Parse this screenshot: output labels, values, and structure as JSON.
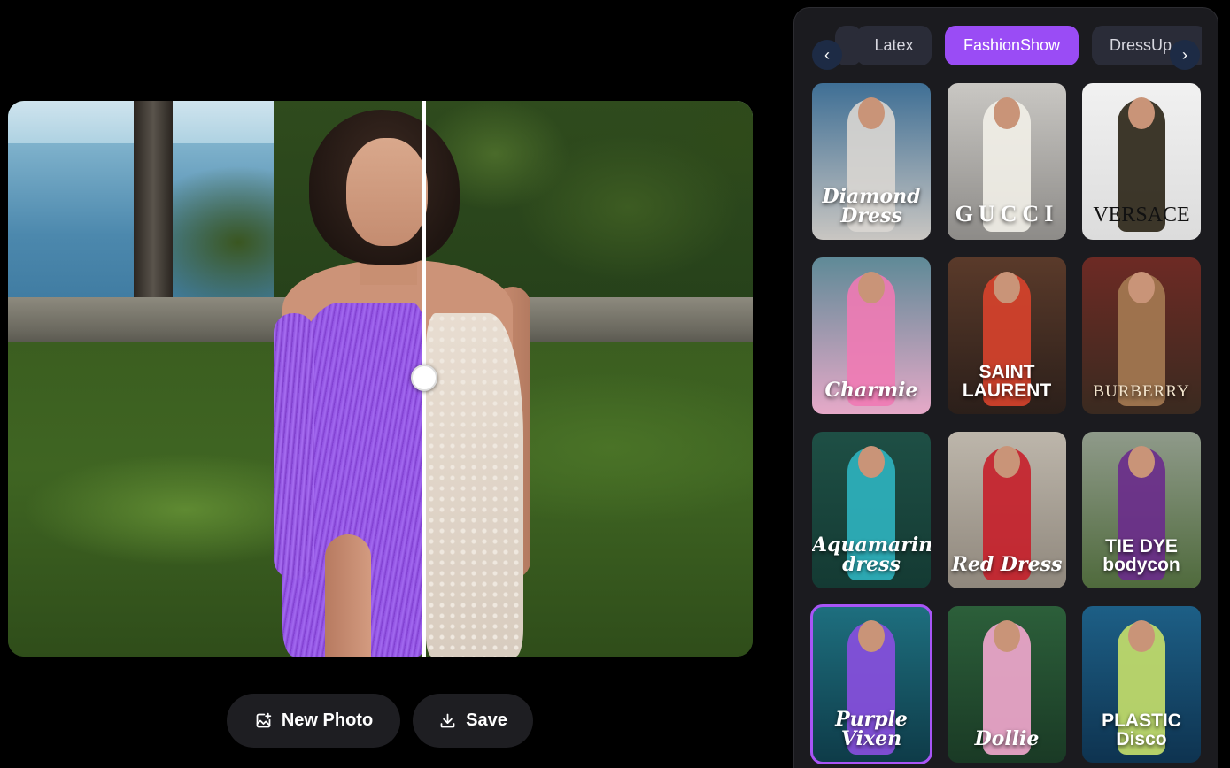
{
  "viewer": {
    "handle_icon": "drag-handle-icon"
  },
  "actions": {
    "new_photo_label": "New Photo",
    "new_photo_icon": "add-image-icon",
    "save_label": "Save",
    "save_icon": "download-icon"
  },
  "tabs": {
    "prev_symbol": "‹",
    "next_symbol": "›",
    "items": [
      {
        "label": ""
      },
      {
        "label": "Latex"
      },
      {
        "label": "FashionShow",
        "active": true
      },
      {
        "label": "DressUp"
      }
    ]
  },
  "styles": [
    {
      "label": "Diamond Dress",
      "line1": "Diamond",
      "line2": "Dress",
      "bg": [
        "#3f6f95",
        "#c9c6c2"
      ],
      "outfit": "#d9d6d2"
    },
    {
      "label": "GUCCI",
      "bg": [
        "#c9c7c3",
        "#8d8b88"
      ],
      "outfit": "#f2efe8"
    },
    {
      "label": "VERSACE",
      "bg": [
        "#f1f1f1",
        "#dcdcdc"
      ],
      "outfit": "#2a2315"
    },
    {
      "label": "Charmie",
      "bg": [
        "#5f8a97",
        "#e6a9c8"
      ],
      "outfit": "#f07ab4"
    },
    {
      "label": "SAINT LAURENT",
      "line1": "SAINT",
      "line2": "LAURENT",
      "bg": [
        "#5a3a2a",
        "#2b1f1a"
      ],
      "outfit": "#d8432c"
    },
    {
      "label": "BURBERRY",
      "bg": [
        "#6d2a24",
        "#3a2a20"
      ],
      "outfit": "#a57a52"
    },
    {
      "label": "Aquamarine dress",
      "line1": "Aquamarine",
      "line2": "dress",
      "bg": [
        "#1e4f45",
        "#143a33"
      ],
      "outfit": "#2fb4c0"
    },
    {
      "label": "Red Dress",
      "bg": [
        "#bdb6ab",
        "#8f877c"
      ],
      "outfit": "#c71f2a"
    },
    {
      "label": "TIE DYE bodycon",
      "line1": "TIE DYE",
      "line2": "bodycon",
      "bg": [
        "#8f9a8a",
        "#4f6a3c"
      ],
      "outfit": "#6a2b8c"
    },
    {
      "label": "Purple Vixen",
      "bg": [
        "#1e6f7f",
        "#0e3b48"
      ],
      "outfit": "#8a4fe0",
      "selected": true
    },
    {
      "label": "Dollie",
      "bg": [
        "#2c5f3a",
        "#1a3a25"
      ],
      "outfit": "#f3a9cf"
    },
    {
      "label": "PLASTIC Disco",
      "line1": "PLASTIC",
      "line2": "Disco",
      "bg": [
        "#1d5f86",
        "#0e3350"
      ],
      "outfit": "#c7e06a"
    }
  ],
  "colors": {
    "accent": "#9a4cf5",
    "panel_bg": "#1b1b1f",
    "tab_bg": "#2a2c38",
    "button_bg": "#1e1e22"
  }
}
